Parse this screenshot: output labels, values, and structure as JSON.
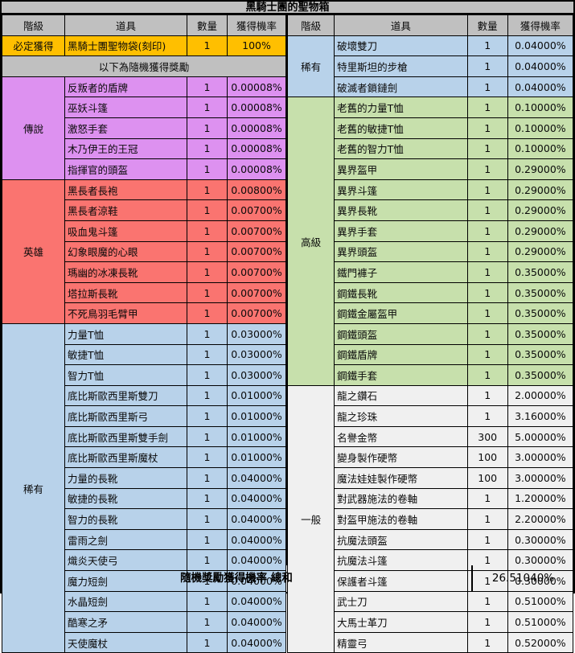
{
  "title": "黑騎士團的聖物箱",
  "columns": {
    "tier": "階級",
    "item": "道具",
    "qty": "數量",
    "rate": "獲得機率"
  },
  "colors": {
    "guaranteed": "#ffbf00",
    "note": "#c0c0c0",
    "legendary": "#dd91f0",
    "hero": "#fa7470",
    "rare": "#b8d2ea",
    "high": "#c7e0ac",
    "common": "#f0f0f0",
    "header": "#c0c0c0"
  },
  "left": {
    "guaranteed": {
      "tier": "必定獲得",
      "item": "黑騎士團聖物袋(刻印)",
      "qty": "1",
      "rate": "100%"
    },
    "note": "以下為隨機獲得獎勵",
    "groups": [
      {
        "tier": "傳說",
        "style": "legendary",
        "rows": [
          {
            "item": "反叛者的盾牌",
            "qty": "1",
            "rate": "0.00008%"
          },
          {
            "item": "巫妖斗篷",
            "qty": "1",
            "rate": "0.00008%"
          },
          {
            "item": "激怒手套",
            "qty": "1",
            "rate": "0.00008%"
          },
          {
            "item": "木乃伊王的王冠",
            "qty": "1",
            "rate": "0.00008%"
          },
          {
            "item": "指揮官的頭盔",
            "qty": "1",
            "rate": "0.00008%"
          }
        ]
      },
      {
        "tier": "英雄",
        "style": "hero",
        "rows": [
          {
            "item": "黑長者長袍",
            "qty": "1",
            "rate": "0.00800%"
          },
          {
            "item": "黑長者涼鞋",
            "qty": "1",
            "rate": "0.00700%"
          },
          {
            "item": "吸血鬼斗篷",
            "qty": "1",
            "rate": "0.00700%"
          },
          {
            "item": "幻象眼魔的心眼",
            "qty": "1",
            "rate": "0.00700%"
          },
          {
            "item": "瑪幽的冰凍長靴",
            "qty": "1",
            "rate": "0.00700%"
          },
          {
            "item": "塔拉斯長靴",
            "qty": "1",
            "rate": "0.00700%"
          },
          {
            "item": "不死鳥羽毛臂甲",
            "qty": "1",
            "rate": "0.00700%"
          }
        ]
      },
      {
        "tier": "稀有",
        "style": "rare",
        "rows": [
          {
            "item": "力量T恤",
            "qty": "1",
            "rate": "0.03000%"
          },
          {
            "item": "敏捷T恤",
            "qty": "1",
            "rate": "0.03000%"
          },
          {
            "item": "智力T恤",
            "qty": "1",
            "rate": "0.03000%"
          },
          {
            "item": "底比斯歐西里斯雙刀",
            "qty": "1",
            "rate": "0.01000%"
          },
          {
            "item": "底比斯歐西里斯弓",
            "qty": "1",
            "rate": "0.01000%"
          },
          {
            "item": "底比斯歐西里斯雙手劍",
            "qty": "1",
            "rate": "0.01000%"
          },
          {
            "item": "底比斯歐西里斯魔杖",
            "qty": "1",
            "rate": "0.01000%"
          },
          {
            "item": "力量的長靴",
            "qty": "1",
            "rate": "0.04000%"
          },
          {
            "item": "敏捷的長靴",
            "qty": "1",
            "rate": "0.04000%"
          },
          {
            "item": "智力的長靴",
            "qty": "1",
            "rate": "0.04000%"
          },
          {
            "item": "雷雨之劍",
            "qty": "1",
            "rate": "0.04000%"
          },
          {
            "item": "熾炎天使弓",
            "qty": "1",
            "rate": "0.04000%"
          },
          {
            "item": "魔力短劍",
            "qty": "1",
            "rate": "0.04000%"
          },
          {
            "item": "水晶短劍",
            "qty": "1",
            "rate": "0.04000%"
          },
          {
            "item": "酷寒之矛",
            "qty": "1",
            "rate": "0.04000%"
          },
          {
            "item": "天使魔杖",
            "qty": "1",
            "rate": "0.04000%"
          }
        ]
      }
    ]
  },
  "right": {
    "groups": [
      {
        "tier": "稀有",
        "style": "rare",
        "rows": [
          {
            "item": "破壞雙刀",
            "qty": "1",
            "rate": "0.04000%"
          },
          {
            "item": "特里斯坦的步槍",
            "qty": "1",
            "rate": "0.04000%"
          },
          {
            "item": "破滅者鎖鏈劍",
            "qty": "1",
            "rate": "0.04000%"
          }
        ]
      },
      {
        "tier": "高級",
        "style": "high",
        "rows": [
          {
            "item": "老舊的力量T恤",
            "qty": "1",
            "rate": "0.10000%"
          },
          {
            "item": "老舊的敏捷T恤",
            "qty": "1",
            "rate": "0.10000%"
          },
          {
            "item": "老舊的智力T恤",
            "qty": "1",
            "rate": "0.10000%"
          },
          {
            "item": "異界盔甲",
            "qty": "1",
            "rate": "0.29000%"
          },
          {
            "item": "異界斗篷",
            "qty": "1",
            "rate": "0.29000%"
          },
          {
            "item": "異界長靴",
            "qty": "1",
            "rate": "0.29000%"
          },
          {
            "item": "異界手套",
            "qty": "1",
            "rate": "0.29000%"
          },
          {
            "item": "異界頭盔",
            "qty": "1",
            "rate": "0.29000%"
          },
          {
            "item": "鐵門褲子",
            "qty": "1",
            "rate": "0.35000%"
          },
          {
            "item": "鋼鐵長靴",
            "qty": "1",
            "rate": "0.35000%"
          },
          {
            "item": "鋼鐵金屬盔甲",
            "qty": "1",
            "rate": "0.35000%"
          },
          {
            "item": "鋼鐵頭盔",
            "qty": "1",
            "rate": "0.35000%"
          },
          {
            "item": "鋼鐵盾牌",
            "qty": "1",
            "rate": "0.35000%"
          },
          {
            "item": "鋼鐵手套",
            "qty": "1",
            "rate": "0.35000%"
          }
        ]
      },
      {
        "tier": "一般",
        "style": "common",
        "rows": [
          {
            "item": "龍之鑽石",
            "qty": "1",
            "rate": "2.00000%"
          },
          {
            "item": "龍之珍珠",
            "qty": "1",
            "rate": "3.16000%"
          },
          {
            "item": "名譽金幣",
            "qty": "300",
            "rate": "5.00000%"
          },
          {
            "item": "變身製作硬幣",
            "qty": "100",
            "rate": "3.00000%"
          },
          {
            "item": "魔法娃娃製作硬幣",
            "qty": "100",
            "rate": "3.00000%"
          },
          {
            "item": "對武器施法的卷軸",
            "qty": "1",
            "rate": "1.20000%"
          },
          {
            "item": "對盔甲施法的卷軸",
            "qty": "1",
            "rate": "2.20000%"
          },
          {
            "item": "抗魔法頭盔",
            "qty": "1",
            "rate": "0.30000%"
          },
          {
            "item": "抗魔法斗篷",
            "qty": "1",
            "rate": "0.30000%"
          },
          {
            "item": "保護者斗篷",
            "qty": "1",
            "rate": "0.30000%"
          },
          {
            "item": "武士刀",
            "qty": "1",
            "rate": "0.51000%"
          },
          {
            "item": "大馬士革刀",
            "qty": "1",
            "rate": "0.51000%"
          },
          {
            "item": "精靈弓",
            "qty": "1",
            "rate": "0.52000%"
          }
        ]
      }
    ]
  },
  "footer": {
    "label": "隨機獎勵獲得機率 總和",
    "value": "26.51040%"
  }
}
